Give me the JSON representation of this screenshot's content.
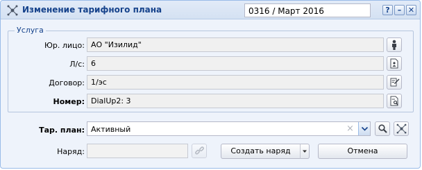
{
  "window": {
    "title": "Изменение тарифного плана",
    "period": "0316 / Март 2016",
    "tools": {
      "help": "?",
      "minimize": "–",
      "close": "✕"
    }
  },
  "service": {
    "legend": "Услуга",
    "fields": [
      {
        "label": "Юр. лицо:",
        "value": "АО \"Изилид\"",
        "icon": "person-icon"
      },
      {
        "label": "Л/с:",
        "value": "6",
        "icon": "account-card-icon"
      },
      {
        "label": "Договор:",
        "value": "1/эс",
        "icon": "contract-edit-icon"
      },
      {
        "label": "Номер:",
        "value": "DialUp2: 3",
        "icon": "document-search-icon"
      }
    ]
  },
  "tariff": {
    "label": "Тар. план:",
    "value": "Активный",
    "clear_glyph": "×"
  },
  "order": {
    "label": "Наряд:",
    "value": "",
    "create_button": "Создать наряд",
    "cancel_button": "Отмена"
  }
}
